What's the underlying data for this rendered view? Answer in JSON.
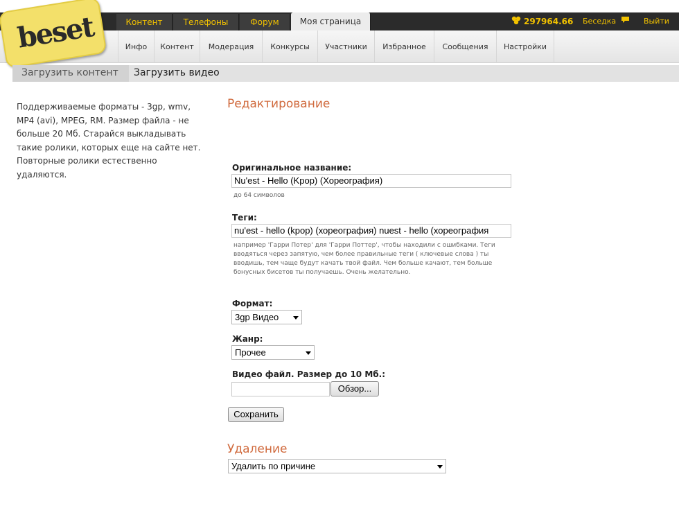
{
  "colors": {
    "accent": "#f2c200",
    "heading": "#d06a3d",
    "topbar": "#2b2b2b"
  },
  "logo": {
    "text": "beset"
  },
  "top_tabs": [
    {
      "label": "Контент"
    },
    {
      "label": "Телефоны"
    },
    {
      "label": "Форум"
    },
    {
      "label": "Моя страница"
    }
  ],
  "header": {
    "balance": "297964.66",
    "balance_icon": "coins-icon",
    "chat_label": "Беседка",
    "chat_icon": "speech-bubble-icon",
    "logout_label": "Выйти",
    "logout_icon": "logout-arrow-icon"
  },
  "sub_nav": [
    {
      "label": "Инфо"
    },
    {
      "label": "Контент"
    },
    {
      "label": "Модерация"
    },
    {
      "label": "Конкурсы"
    },
    {
      "label": "Участники"
    },
    {
      "label": "Избранное"
    },
    {
      "label": "Сообщения"
    },
    {
      "label": "Настройки"
    }
  ],
  "breadcrumb": {
    "parent": "Загрузить контент",
    "current": "Загрузить видео"
  },
  "info_text": "Поддерживаемые форматы - 3gp, wmv, MP4 (avi), MPEG, RM. Размер файла - не больше 20 Мб. Старайся выкладывать такие ролики, которых еще на сайте нет. Повторные ролики естественно удаляются.",
  "form": {
    "section_title": "Редактирование",
    "title_label": "Оригинальное название:",
    "title_value": "Nu'est - Hello (Kpop) (Хореография)",
    "title_hint": "до 64 символов",
    "tags_label": "Теги:",
    "tags_value": "nu'est - hello (kpop) (хореография)  nuest - hello (хореография",
    "tags_hint": "например 'Гарри Потер' для 'Гарри Поттер', чтобы находили с ошибками. Теги вводяться через запятую, чем более правильные теги ( ключевые слова ) ты вводишь, тем чаще будут качать твой файл. Чем больше качают, тем больше бонусных бисетов ты получаешь. Очень желательно.",
    "format_label": "Формат:",
    "format_value": "3gp Видео",
    "genre_label": "Жанр:",
    "genre_value": "Прочее",
    "file_label": "Видео файл. Размер до 10 Мб.:",
    "browse_label": "Обзор...",
    "save_label": "Сохранить"
  },
  "delete": {
    "section_title": "Удаление",
    "reason_value": "Удалить по причине"
  }
}
